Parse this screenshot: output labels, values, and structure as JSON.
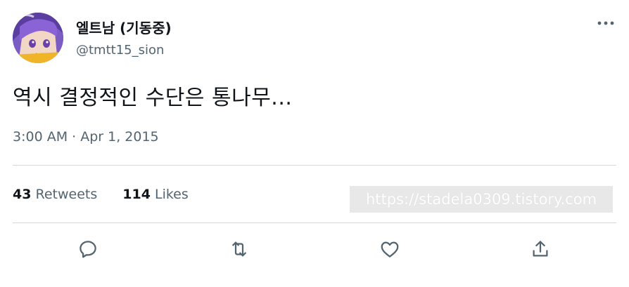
{
  "author": {
    "display_name": "엘트남 (기동중)",
    "handle": "@tmtt15_sion",
    "avatar_icon": "user-avatar"
  },
  "tweet": {
    "text": "역시 결정적인 수단은 통나무...",
    "timestamp": "3:00 AM · Apr 1, 2015"
  },
  "stats": {
    "retweets_count": "43",
    "retweets_label": "Retweets",
    "likes_count": "114",
    "likes_label": "Likes"
  },
  "watermark": "https://stadela0309.tistory.com",
  "actions": {
    "reply_icon": "reply-icon",
    "retweet_icon": "retweet-icon",
    "like_icon": "heart-icon",
    "share_icon": "share-icon",
    "more_icon": "more-options-icon"
  },
  "colors": {
    "primary_text": "#0f1419",
    "secondary_text": "#536471",
    "divider": "#cfd9de"
  }
}
